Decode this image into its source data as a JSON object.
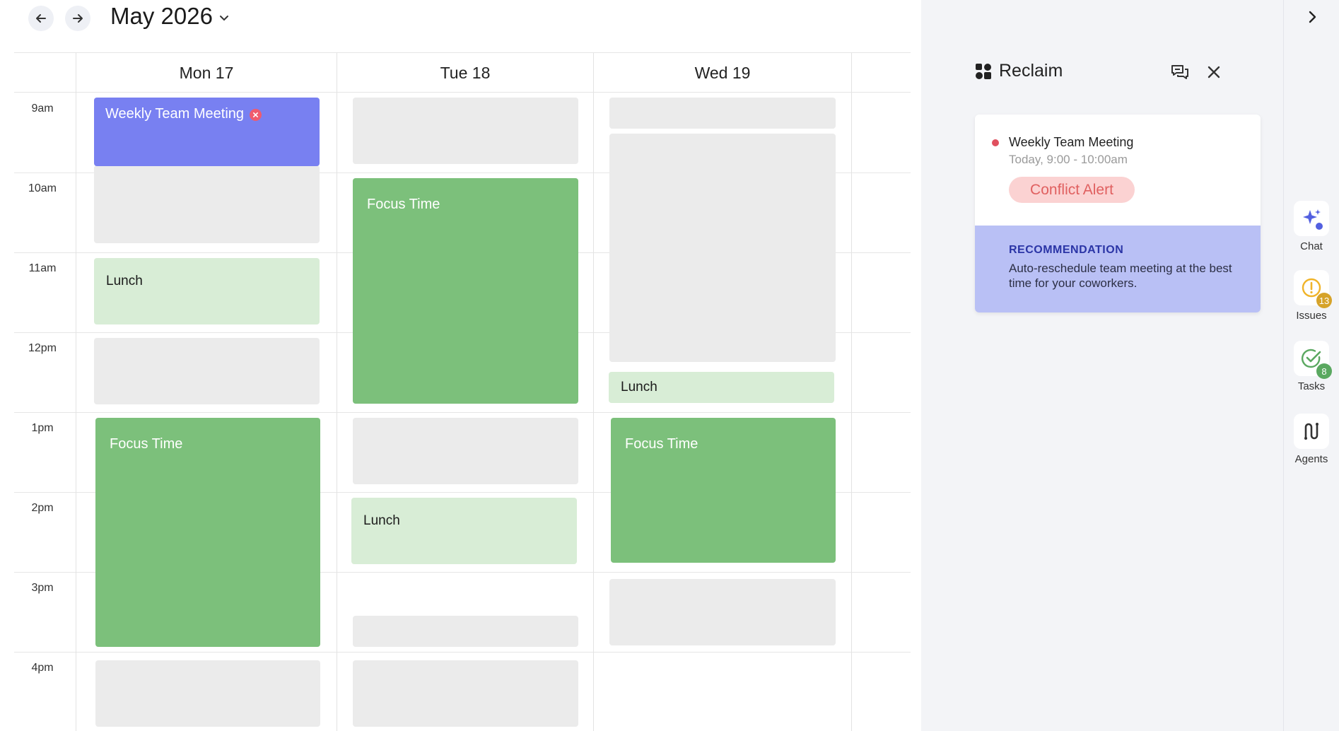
{
  "header": {
    "month": "May 2026"
  },
  "days": [
    {
      "label": "Mon 17"
    },
    {
      "label": "Tue 18"
    },
    {
      "label": "Wed 19"
    }
  ],
  "times": [
    "9am",
    "10am",
    "11am",
    "12pm",
    "1pm",
    "2pm",
    "3pm",
    "4pm"
  ],
  "events": {
    "mon_meeting": "Weekly Team Meeting",
    "mon_lunch": "Lunch",
    "mon_focus": "Focus Time",
    "tue_focus": "Focus Time",
    "tue_lunch": "Lunch",
    "wed_lunch": "Lunch",
    "wed_focus": "Focus Time"
  },
  "panel": {
    "app_name": "Reclaim",
    "card": {
      "title": "Weekly Team Meeting",
      "subtitle": "Today, 9:00 - 10:00am",
      "alert": "Conflict Alert",
      "rec_title": "RECOMMENDATION",
      "rec_text": "Auto-reschedule team meeting at the best time for your coworkers."
    }
  },
  "rail": {
    "chat": "Chat",
    "issues": "Issues",
    "issues_count": "13",
    "tasks": "Tasks",
    "tasks_count": "8",
    "agents": "Agents"
  },
  "colors": {
    "meeting": "#7880f1",
    "focus": "#7cc07b",
    "lunch": "#d8edd6",
    "placeholder": "#ebebeb",
    "recommendation": "#b9c0f5",
    "conflict": "#fbd2d2"
  }
}
